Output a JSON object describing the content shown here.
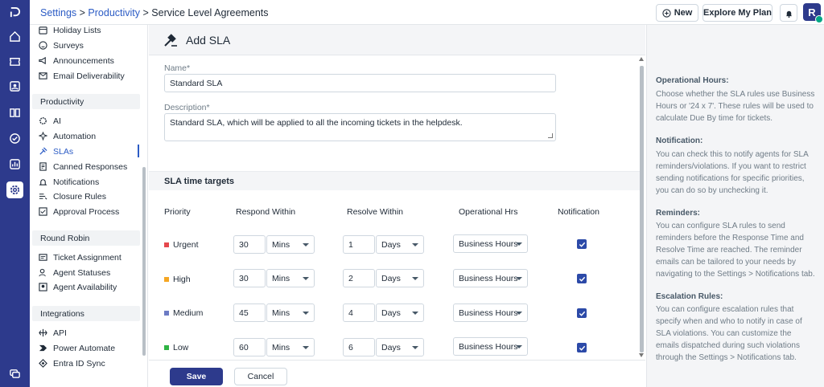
{
  "breadcrumb": {
    "settings": "Settings",
    "sep1": " > ",
    "productivity": "Productivity",
    "sep2": " > ",
    "current": "Service Level Agreements"
  },
  "header": {
    "new_label": "New",
    "plan_label": "Explore My Plan",
    "avatar_initial": "R"
  },
  "sidebar": {
    "items_top": [
      {
        "label": "Holiday Lists",
        "icon": "calendar-icon"
      },
      {
        "label": "Surveys",
        "icon": "smile-icon"
      },
      {
        "label": "Announcements",
        "icon": "megaphone-icon"
      },
      {
        "label": "Email Deliverability",
        "icon": "mail-icon"
      }
    ],
    "productivity_header": "Productivity",
    "productivity_items": [
      {
        "label": "AI",
        "icon": "ai-gear-icon"
      },
      {
        "label": "Automation",
        "icon": "sparkle-icon"
      },
      {
        "label": "SLAs",
        "icon": "gavel-icon"
      },
      {
        "label": "Canned Responses",
        "icon": "document-icon"
      },
      {
        "label": "Notifications",
        "icon": "bell-icon"
      },
      {
        "label": "Closure Rules",
        "icon": "rules-icon"
      },
      {
        "label": "Approval Process",
        "icon": "approval-icon"
      }
    ],
    "round_robin_header": "Round Robin",
    "round_robin_items": [
      {
        "label": "Ticket Assignment",
        "icon": "ticket-assign-icon"
      },
      {
        "label": "Agent Statuses",
        "icon": "agent-status-icon"
      },
      {
        "label": "Agent Availability",
        "icon": "agent-availability-icon"
      }
    ],
    "integrations_header": "Integrations",
    "integrations_items": [
      {
        "label": "API",
        "icon": "api-icon"
      },
      {
        "label": "Power Automate",
        "icon": "power-automate-icon"
      },
      {
        "label": "Entra ID Sync",
        "icon": "sync-icon"
      }
    ]
  },
  "form": {
    "title": "Add SLA",
    "name_label": "Name*",
    "name_value": "Standard SLA",
    "description_label": "Description*",
    "description_value": "Standard SLA, which will be applied to all the incoming tickets in the helpdesk.",
    "section_title": "SLA time targets",
    "columns": [
      "Priority",
      "Respond Within",
      "Resolve Within",
      "Operational Hrs",
      "Notification"
    ],
    "rows": [
      {
        "priority": "Urgent",
        "color": "#e5484d",
        "respond_value": "30",
        "respond_unit": "Mins",
        "resolve_value": "1",
        "resolve_unit": "Days",
        "hours": "Business Hours",
        "notify": true
      },
      {
        "priority": "High",
        "color": "#f5a623",
        "respond_value": "30",
        "respond_unit": "Mins",
        "resolve_value": "2",
        "resolve_unit": "Days",
        "hours": "Business Hours",
        "notify": true
      },
      {
        "priority": "Medium",
        "color": "#6c7bc4",
        "respond_value": "45",
        "respond_unit": "Mins",
        "resolve_value": "4",
        "resolve_unit": "Days",
        "hours": "Business Hours",
        "notify": true
      },
      {
        "priority": "Low",
        "color": "#2fb344",
        "respond_value": "60",
        "respond_unit": "Mins",
        "resolve_value": "6",
        "resolve_unit": "Days",
        "hours": "Business Hours",
        "notify": true
      }
    ],
    "save_label": "Save",
    "cancel_label": "Cancel"
  },
  "help": {
    "op_title": "Operational Hours:",
    "op_text": "Choose whether the SLA rules use Business Hours or '24 x 7'. These rules will be used to calculate Due By time for tickets.",
    "notif_title": "Notification:",
    "notif_text": "You can check this to notify agents for SLA reminders/violations. If you want to restrict sending notifications for specific priorities, you can do so by unchecking it.",
    "rem_title": "Reminders:",
    "rem_text": "You can configure SLA rules to send reminders before the Response Time and Resolve Time are reached. The reminder emails can be tailored to your needs by navigating to the Settings > Notifications tab.",
    "esc_title": "Escalation Rules:",
    "esc_text": "You can configure escalation rules that specify when and who to notify in case of SLA violations. You can customize the emails dispatched during such violations through the Settings > Notifications tab."
  },
  "colors": {
    "brand": "#2d3a8c",
    "link": "#2c5cc5",
    "checkbox": "#2c4aa8"
  }
}
